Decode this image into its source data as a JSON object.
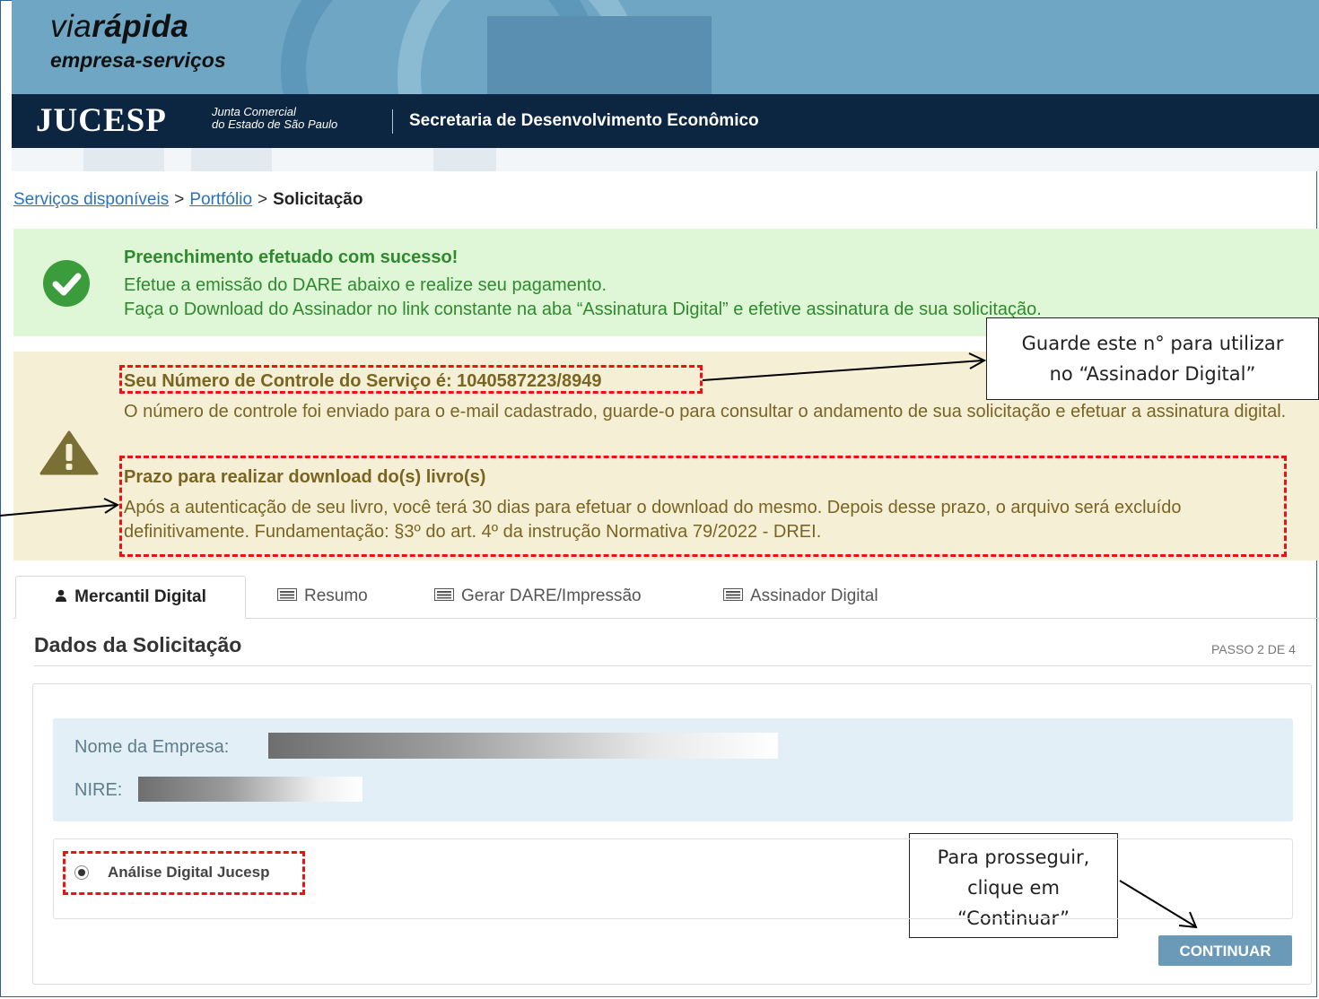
{
  "header": {
    "logo_via": "via",
    "logo_rapida": "rápida",
    "logo_subtitle": "empresa-serviços",
    "jucesp": "JUCESP",
    "junta_line1": "Junta Comercial",
    "junta_line2": "do Estado de São Paulo",
    "secretaria": "Secretaria de Desenvolvimento Econômico"
  },
  "breadcrumb": {
    "item1": "Serviços disponíveis",
    "item2": "Portfólio",
    "current": "Solicitação",
    "separator": ">"
  },
  "success_alert": {
    "title": "Preenchimento efetuado com sucesso!",
    "line1": "Efetue a emissão do DARE abaixo e realize seu pagamento.",
    "line2": "Faça o Download do Assinador no link constante na aba “Assinatura Digital” e efetive assinatura de sua solicitação.",
    "icon": "check-circle-icon",
    "color": "#2f8a2f"
  },
  "warning_alert": {
    "control_number_text": "Seu Número de Controle do Serviço é: 1040587223/8949",
    "paragraph1": "O número de controle foi enviado para o e-mail cadastrado, guarde-o para consultar o andamento de sua solicitação e efetuar a assinatura digital.",
    "prazo_title": "Prazo para realizar download do(s) livro(s)",
    "prazo_text": "Após a autenticação de seu livro, você terá 30 dias para efetuar o download do mesmo. Depois desse prazo, o arquivo será excluído definitivamente. Fundamentação: §3º do art. 4º da instrução Normativa 79/2022 - DREI.",
    "icon": "warning-triangle-icon",
    "color": "#7a6422"
  },
  "callouts": {
    "assinador_line1": "Guarde este n° para utilizar",
    "assinador_line2": "no  “Assinador Digital”",
    "continuar_line1": "Para prosseguir,",
    "continuar_line2": "clique em",
    "continuar_line3": "“Continuar”"
  },
  "tabs": [
    {
      "label": "Mercantil Digital",
      "icon": "user-icon",
      "active": true
    },
    {
      "label": "Resumo",
      "icon": "list-icon",
      "active": false
    },
    {
      "label": "Gerar DARE/Impressão",
      "icon": "list-icon",
      "active": false
    },
    {
      "label": "Assinador Digital",
      "icon": "list-icon",
      "active": false
    }
  ],
  "section": {
    "title": "Dados da Solicitação",
    "step": "PASSO 2 DE 4"
  },
  "company": {
    "name_label": "Nome da Empresa:",
    "nire_label": "NIRE:"
  },
  "option": {
    "label": "Análise Digital Jucesp",
    "selected": true
  },
  "actions": {
    "continue_label": "CONTINUAR",
    "accent": "#6a9ab7"
  }
}
